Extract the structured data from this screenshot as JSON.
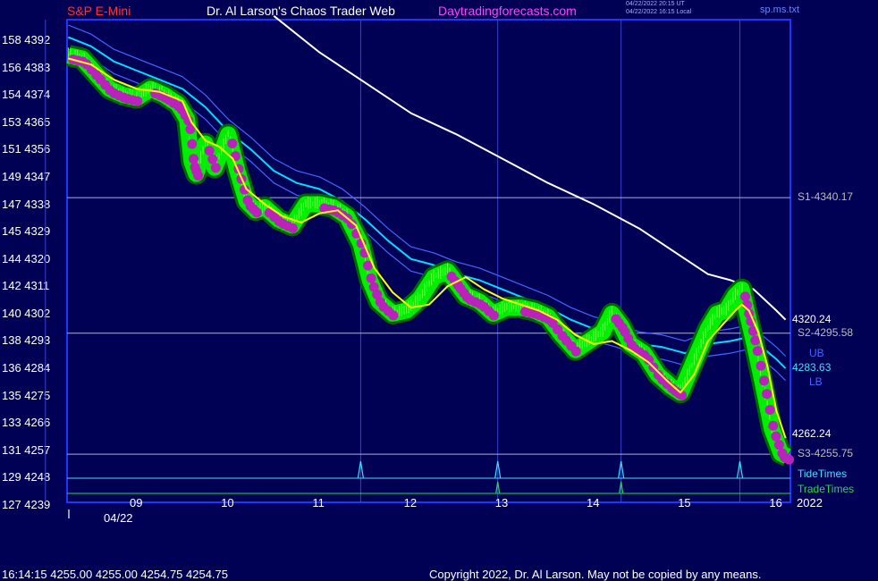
{
  "header": {
    "symbol": "S&P E-Mini",
    "site_title": "Dr. Al Larson's Chaos Trader Web",
    "url": "Daytradingforecasts.com",
    "timestamp_utc": "04/22/2022 20:15 UT",
    "timestamp_local": "04/22/2022 16:15 Local",
    "file": "sp.ms.txt"
  },
  "colors": {
    "background": "#000055",
    "symbol": "#ff3333",
    "url": "#ff44ff",
    "price": "#00ee00",
    "volume_dots": "#bb22bb",
    "mid_line": "#ffff00",
    "long_ma": "#ffffff",
    "cyan_ma": "#00ddff",
    "band": "#4466ff",
    "tide": "#44ddff",
    "trade": "#22dd44"
  },
  "chart_data": {
    "type": "line",
    "title": "S&P E-Mini",
    "xlabel": "",
    "ylabel": "",
    "x_ticks": [
      "09",
      "10",
      "11",
      "12",
      "13",
      "14",
      "15",
      "16"
    ],
    "date_label": "04/22",
    "year_label": "2022",
    "ylim": [
      4239,
      4398
    ],
    "left_axis": [
      {
        "a": "158",
        "p": "4392"
      },
      {
        "a": "156",
        "p": "4383"
      },
      {
        "a": "154",
        "p": "4374"
      },
      {
        "a": "153",
        "p": "4365"
      },
      {
        "a": "151",
        "p": "4356"
      },
      {
        "a": "149",
        "p": "4347"
      },
      {
        "a": "147",
        "p": "4338"
      },
      {
        "a": "145",
        "p": "4329"
      },
      {
        "a": "144",
        "p": "4320"
      },
      {
        "a": "142",
        "p": "4311"
      },
      {
        "a": "140",
        "p": "4302"
      },
      {
        "a": "138",
        "p": "4293"
      },
      {
        "a": "136",
        "p": "4284"
      },
      {
        "a": "135",
        "p": "4275"
      },
      {
        "a": "133",
        "p": "4266"
      },
      {
        "a": "131",
        "p": "4257"
      },
      {
        "a": "129",
        "p": "4248"
      },
      {
        "a": "127",
        "p": "4239"
      }
    ],
    "hours": [
      8.25,
      11.5
    ],
    "series": [
      {
        "key": "price",
        "x": [
          8.25,
          8.4,
          8.55,
          8.7,
          8.85,
          9.0,
          9.15,
          9.3,
          9.45,
          9.55,
          9.6,
          9.65,
          9.75,
          9.85,
          9.95,
          10.0,
          10.1,
          10.2,
          10.3,
          10.4,
          10.55,
          10.7,
          10.85,
          11.0,
          11.15,
          11.3,
          11.45,
          11.55,
          11.65,
          11.8,
          11.95,
          12.1,
          12.25,
          12.4,
          12.5,
          12.6,
          12.75,
          12.9,
          13.05,
          13.2,
          13.35,
          13.5,
          13.65,
          13.8,
          13.95,
          14.1,
          14.2,
          14.3,
          14.4,
          14.55,
          14.7,
          14.85,
          14.95,
          15.05,
          15.15,
          15.25,
          15.35,
          15.45,
          15.55,
          15.62,
          15.68,
          15.75,
          15.85,
          15.95,
          16.05,
          16.12
        ],
        "y": [
          4387,
          4386,
          4381,
          4376,
          4374,
          4373,
          4376,
          4374,
          4371,
          4366,
          4352,
          4348,
          4358,
          4350,
          4357,
          4361,
          4349,
          4339,
          4336,
          4337,
          4333,
          4331,
          4338,
          4338,
          4337,
          4334,
          4325,
          4313,
          4306,
          4302,
          4303,
          4307,
          4314,
          4316,
          4312,
          4308,
          4306,
          4302,
          4304,
          4304,
          4303,
          4301,
          4295,
          4290,
          4293,
          4296,
          4302,
          4298,
          4292,
          4289,
          4282,
          4278,
          4276,
          4283,
          4290,
          4297,
          4302,
          4303,
          4308,
          4310,
          4302,
          4293,
          4279,
          4264,
          4256,
          4255
        ]
      },
      {
        "key": "mid",
        "x": [
          8.25,
          8.5,
          8.75,
          9.0,
          9.25,
          9.5,
          9.6,
          9.75,
          9.9,
          10.05,
          10.2,
          10.4,
          10.6,
          10.8,
          11.0,
          11.2,
          11.4,
          11.6,
          11.8,
          12.0,
          12.2,
          12.4,
          12.6,
          12.8,
          13.0,
          13.2,
          13.4,
          13.6,
          13.8,
          14.0,
          14.2,
          14.4,
          14.6,
          14.8,
          14.95,
          15.1,
          15.25,
          15.4,
          15.55,
          15.62,
          15.7,
          15.8,
          15.9,
          16.0,
          16.1
        ],
        "y": [
          4386,
          4384,
          4379,
          4376,
          4375,
          4372,
          4365,
          4359,
          4357,
          4353,
          4343,
          4338,
          4334,
          4332,
          4335,
          4336,
          4331,
          4317,
          4309,
          4304,
          4305,
          4311,
          4314,
          4310,
          4307,
          4305,
          4303,
          4300,
          4295,
          4292,
          4293,
          4290,
          4286,
          4280,
          4276,
          4282,
          4293,
          4298,
          4303,
          4305,
          4303,
          4296,
          4285,
          4270,
          4261
        ]
      },
      {
        "key": "long_ma",
        "x": [
          10.5,
          11.0,
          11.5,
          12.0,
          12.5,
          13.0,
          13.5,
          14.0,
          14.5,
          15.0,
          15.25,
          15.5,
          15.75,
          16.0,
          16.1
        ],
        "y": [
          4400,
          4388,
          4378,
          4368,
          4361,
          4353,
          4345,
          4338,
          4330,
          4320,
          4315,
          4313,
          4310,
          4303,
          4300
        ]
      },
      {
        "key": "cyan_ma",
        "x": [
          8.25,
          8.5,
          8.75,
          9.0,
          9.25,
          9.5,
          9.75,
          10.0,
          10.25,
          10.5,
          10.75,
          11.0,
          11.25,
          11.5,
          11.75,
          12.0,
          12.25,
          12.5,
          12.75,
          13.0,
          13.25,
          13.5,
          13.75,
          14.0,
          14.25,
          14.5,
          14.75,
          15.0,
          15.25,
          15.5,
          15.65,
          15.8,
          16.0,
          16.1
        ],
        "y": [
          4393,
          4390,
          4385,
          4382,
          4379,
          4376,
          4370,
          4362,
          4356,
          4349,
          4345,
          4343,
          4339,
          4333,
          4326,
          4320,
          4318,
          4315,
          4313,
          4310,
          4307,
          4304,
          4300,
          4297,
          4295,
          4292,
          4291,
          4289,
          4292,
          4293,
          4294,
          4292,
          4287,
          4284
        ]
      },
      {
        "key": "ub",
        "x": [
          8.25,
          8.5,
          8.75,
          9.0,
          9.25,
          9.5,
          9.75,
          10.0,
          10.25,
          10.5,
          10.75,
          11.0,
          11.25,
          11.5,
          11.75,
          12.0,
          12.25,
          12.5,
          12.75,
          13.0,
          13.25,
          13.5,
          13.75,
          14.0,
          14.25,
          14.5,
          14.75,
          15.0,
          15.25,
          15.5,
          15.65,
          15.8,
          16.0,
          16.1
        ],
        "y": [
          4397,
          4394,
          4389,
          4386,
          4383,
          4380,
          4374,
          4366,
          4360,
          4353,
          4349,
          4347,
          4343,
          4337,
          4330,
          4324,
          4322,
          4319,
          4317,
          4314,
          4311,
          4308,
          4304,
          4301,
          4299,
          4296,
          4295,
          4293,
          4296,
          4297,
          4298,
          4296,
          4291,
          4288
        ]
      },
      {
        "key": "lb",
        "x": [
          8.25,
          8.5,
          8.75,
          9.0,
          9.25,
          9.5,
          9.75,
          10.0,
          10.25,
          10.5,
          10.75,
          11.0,
          11.25,
          11.5,
          11.75,
          12.0,
          12.25,
          12.5,
          12.75,
          13.0,
          13.25,
          13.5,
          13.75,
          14.0,
          14.25,
          14.5,
          14.75,
          15.0,
          15.25,
          15.5,
          15.65,
          15.8,
          16.0,
          16.1
        ],
        "y": [
          4389,
          4386,
          4381,
          4378,
          4375,
          4372,
          4366,
          4358,
          4352,
          4345,
          4341,
          4339,
          4335,
          4329,
          4322,
          4316,
          4314,
          4311,
          4309,
          4306,
          4303,
          4300,
          4296,
          4293,
          4291,
          4288,
          4287,
          4285,
          4288,
          4289,
          4290,
          4288,
          4283,
          4280
        ]
      }
    ],
    "support_levels": [
      {
        "label": "S1-4340.17",
        "value": 4340.17
      },
      {
        "label": "S2-4295.58",
        "value": 4295.58
      },
      {
        "label": "S3-4255.75",
        "value": 4255.75
      }
    ],
    "right_labels": {
      "long_ma": "4320.24",
      "ub": "UB",
      "cyan": "4283.63",
      "lb": "LB",
      "mid": "4262.24"
    },
    "vertical_lines": [
      8.0,
      11.45,
      12.95,
      14.3,
      15.6
    ],
    "tide_label": "TideTimes",
    "tide_spikes": [
      11.45,
      12.95,
      14.3,
      15.6
    ],
    "trade_label": "TradeTimes",
    "trade_spikes": [
      12.95,
      14.3
    ]
  },
  "footer": {
    "quote": "16:14:15  4255.00 4255.00 4254.75 4254.75",
    "copyright": "Copyright 2022, Dr. Al Larson. May not be copied by any means."
  }
}
